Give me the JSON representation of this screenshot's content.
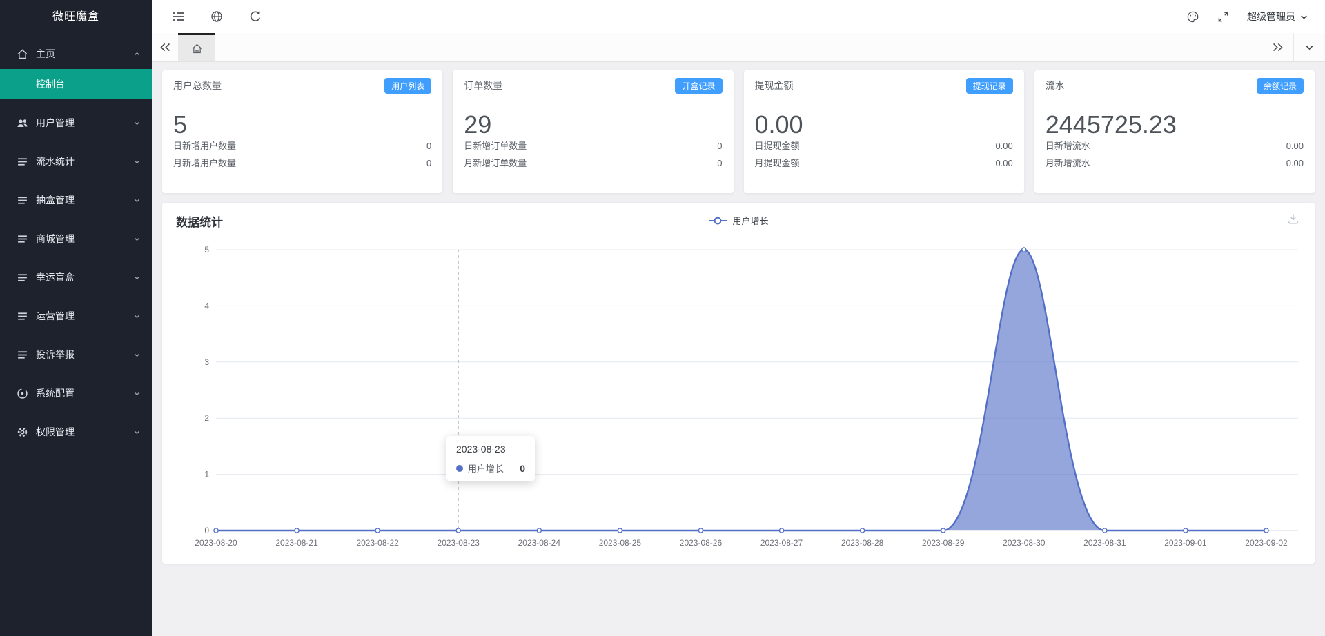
{
  "sidebar": {
    "logo": "微旺魔盒",
    "items": [
      {
        "label": "主页",
        "icon": "home-icon",
        "expanded": true,
        "children": [
          {
            "label": "控制台",
            "active": true
          }
        ]
      },
      {
        "label": "用户管理",
        "icon": "users-icon"
      },
      {
        "label": "流水统计",
        "icon": "list-icon"
      },
      {
        "label": "抽盒管理",
        "icon": "list-icon"
      },
      {
        "label": "商城管理",
        "icon": "list-icon"
      },
      {
        "label": "幸运盲盒",
        "icon": "list-icon"
      },
      {
        "label": "运营管理",
        "icon": "list-icon"
      },
      {
        "label": "投诉举报",
        "icon": "list-icon"
      },
      {
        "label": "系统配置",
        "icon": "config-icon"
      },
      {
        "label": "权限管理",
        "icon": "gear-icon"
      }
    ]
  },
  "header": {
    "admin_label": "超级管理员",
    "icons": [
      "fold-icon",
      "globe-icon",
      "refresh-icon",
      "palette-icon",
      "fullscreen-icon"
    ]
  },
  "stat_cards": [
    {
      "title": "用户总数量",
      "badge": "用户列表",
      "value": "5",
      "rows": [
        {
          "label": "日新增用户数量",
          "value": "0"
        },
        {
          "label": "月新增用户数量",
          "value": "0"
        }
      ]
    },
    {
      "title": "订单数量",
      "badge": "开盒记录",
      "value": "29",
      "rows": [
        {
          "label": "日新增订单数量",
          "value": "0"
        },
        {
          "label": "月新增订单数量",
          "value": "0"
        }
      ]
    },
    {
      "title": "提现金额",
      "badge": "提现记录",
      "value": "0.00",
      "rows": [
        {
          "label": "日提现金额",
          "value": "0.00"
        },
        {
          "label": "月提现金额",
          "value": "0.00"
        }
      ]
    },
    {
      "title": "流水",
      "badge": "余额记录",
      "value": "2445725.23",
      "rows": [
        {
          "label": "日新增流水",
          "value": "0.00"
        },
        {
          "label": "月新增流水",
          "value": "0.00"
        }
      ]
    }
  ],
  "colors": {
    "sidebar_bg": "#1e222d",
    "active_teal": "#0aa08a",
    "badge_blue": "#409eff"
  },
  "chart_data": {
    "type": "area",
    "title": "数据统计",
    "categories": [
      "2023-08-20",
      "2023-08-21",
      "2023-08-22",
      "2023-08-23",
      "2023-08-24",
      "2023-08-25",
      "2023-08-26",
      "2023-08-27",
      "2023-08-28",
      "2023-08-29",
      "2023-08-30",
      "2023-08-31",
      "2023-09-01",
      "2023-09-02"
    ],
    "series": [
      {
        "name": "用户增长",
        "values": [
          0,
          0,
          0,
          0,
          0,
          0,
          0,
          0,
          0,
          0,
          5,
          0,
          0,
          0
        ]
      }
    ],
    "ylim": [
      0,
      5
    ],
    "yticks": [
      0,
      1,
      2,
      3,
      4,
      5
    ],
    "grid": true,
    "legend_position": "top-center",
    "line_color": "#5470c6",
    "fill_color": "rgba(84,112,198,0.62)",
    "tooltip": {
      "date": "2023-08-23",
      "series": "用户增长",
      "value": "0",
      "index": 3
    }
  }
}
